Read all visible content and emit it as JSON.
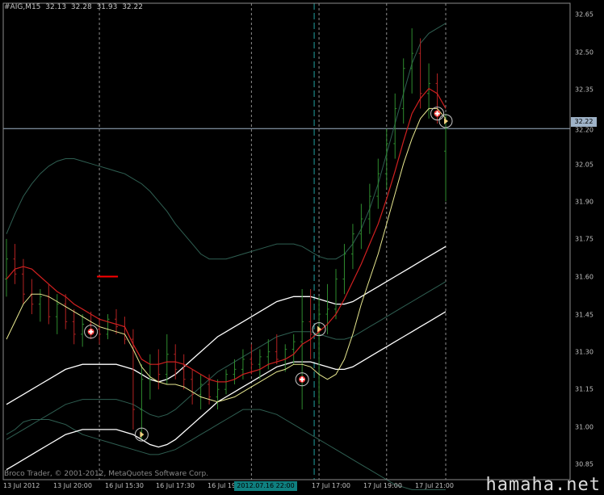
{
  "header": {
    "symbol": "#AIG,M15",
    "open": "32.13",
    "high": "32.28",
    "low": "31.93",
    "close": "32.22"
  },
  "copyright": "Broco Trader, © 2001-2012, MetaQuotes Software Corp.",
  "watermark": "hamaha.net",
  "price_axis": {
    "ticks": [
      "32.65",
      "32.50",
      "32.35",
      "32.20",
      "32.05",
      "31.90",
      "31.75",
      "31.60",
      "31.45",
      "31.30",
      "31.15",
      "31.00",
      "30.85"
    ],
    "current_price": "32.22"
  },
  "time_axis": {
    "ticks": [
      "13 Jul 2012",
      "13 Jul 20:00",
      "16 Jul 15:30",
      "16 Jul 17:30",
      "16 Jul 19:",
      "17 Jul 17:00",
      "17 Jul 19:00",
      "17 Jul 21:00"
    ],
    "crosshair_label": "2012.07.16 22:00"
  },
  "colors": {
    "background": "#000000",
    "bull": "#2e8b2e",
    "bear": "#b22222",
    "ma_fast": "#d02020",
    "ma_slow": "#e8e890",
    "envelope": "#ffffff",
    "band_outer": "#2f5f52",
    "crosshair": "#9fb3c8",
    "grid": "#8c8c8c"
  },
  "chart_data": {
    "type": "candlestick",
    "symbol": "#AIG",
    "timeframe": "M15",
    "ylim": [
      30.82,
      32.72
    ],
    "current_price": 32.22,
    "bars": [
      {
        "o": 31.62,
        "h": 31.78,
        "l": 31.55,
        "c": 31.7
      },
      {
        "o": 31.7,
        "h": 31.76,
        "l": 31.6,
        "c": 31.64
      },
      {
        "o": 31.64,
        "h": 31.7,
        "l": 31.52,
        "c": 31.56
      },
      {
        "o": 31.56,
        "h": 31.62,
        "l": 31.48,
        "c": 31.52
      },
      {
        "o": 31.52,
        "h": 31.58,
        "l": 31.45,
        "c": 31.55
      },
      {
        "o": 31.55,
        "h": 31.6,
        "l": 31.44,
        "c": 31.47
      },
      {
        "o": 31.47,
        "h": 31.56,
        "l": 31.4,
        "c": 31.52
      },
      {
        "o": 31.52,
        "h": 31.56,
        "l": 31.42,
        "c": 31.45
      },
      {
        "o": 31.45,
        "h": 31.5,
        "l": 31.36,
        "c": 31.4
      },
      {
        "o": 31.4,
        "h": 31.48,
        "l": 31.35,
        "c": 31.44
      },
      {
        "o": 31.44,
        "h": 31.49,
        "l": 31.38,
        "c": 31.42
      },
      {
        "o": 31.42,
        "h": 31.46,
        "l": 31.36,
        "c": 31.4
      },
      {
        "o": 31.4,
        "h": 31.48,
        "l": 31.38,
        "c": 31.46
      },
      {
        "o": 31.46,
        "h": 31.5,
        "l": 31.4,
        "c": 31.43
      },
      {
        "o": 31.43,
        "h": 31.47,
        "l": 31.36,
        "c": 31.38
      },
      {
        "o": 31.38,
        "h": 31.42,
        "l": 31.02,
        "c": 31.1
      },
      {
        "o": 31.1,
        "h": 31.28,
        "l": 30.98,
        "c": 31.22
      },
      {
        "o": 31.22,
        "h": 31.32,
        "l": 31.14,
        "c": 31.28
      },
      {
        "o": 31.28,
        "h": 31.34,
        "l": 31.18,
        "c": 31.24
      },
      {
        "o": 31.24,
        "h": 31.4,
        "l": 31.2,
        "c": 31.32
      },
      {
        "o": 31.32,
        "h": 31.36,
        "l": 31.22,
        "c": 31.26
      },
      {
        "o": 31.26,
        "h": 31.32,
        "l": 31.18,
        "c": 31.22
      },
      {
        "o": 31.22,
        "h": 31.26,
        "l": 31.12,
        "c": 31.16
      },
      {
        "o": 31.16,
        "h": 31.24,
        "l": 31.1,
        "c": 31.2
      },
      {
        "o": 31.2,
        "h": 31.24,
        "l": 31.12,
        "c": 31.15
      },
      {
        "o": 31.15,
        "h": 31.22,
        "l": 31.1,
        "c": 31.18
      },
      {
        "o": 31.18,
        "h": 31.26,
        "l": 31.16,
        "c": 31.24
      },
      {
        "o": 31.24,
        "h": 31.3,
        "l": 31.2,
        "c": 31.26
      },
      {
        "o": 31.26,
        "h": 31.34,
        "l": 31.22,
        "c": 31.3
      },
      {
        "o": 31.3,
        "h": 31.36,
        "l": 31.24,
        "c": 31.28
      },
      {
        "o": 31.28,
        "h": 31.34,
        "l": 31.22,
        "c": 31.31
      },
      {
        "o": 31.31,
        "h": 31.38,
        "l": 31.26,
        "c": 31.33
      },
      {
        "o": 31.33,
        "h": 31.4,
        "l": 31.28,
        "c": 31.3
      },
      {
        "o": 31.3,
        "h": 31.36,
        "l": 31.25,
        "c": 31.34
      },
      {
        "o": 31.34,
        "h": 31.4,
        "l": 31.28,
        "c": 31.37
      },
      {
        "o": 31.37,
        "h": 31.58,
        "l": 31.1,
        "c": 31.45
      },
      {
        "o": 31.45,
        "h": 31.58,
        "l": 31.3,
        "c": 31.4
      },
      {
        "o": 31.4,
        "h": 31.55,
        "l": 31.12,
        "c": 31.48
      },
      {
        "o": 31.48,
        "h": 31.6,
        "l": 31.4,
        "c": 31.5
      },
      {
        "o": 31.5,
        "h": 31.66,
        "l": 31.46,
        "c": 31.62
      },
      {
        "o": 31.62,
        "h": 31.76,
        "l": 31.56,
        "c": 31.72
      },
      {
        "o": 31.72,
        "h": 31.84,
        "l": 31.66,
        "c": 31.8
      },
      {
        "o": 31.8,
        "h": 31.92,
        "l": 31.74,
        "c": 31.86
      },
      {
        "o": 31.86,
        "h": 32.0,
        "l": 31.8,
        "c": 31.95
      },
      {
        "o": 31.95,
        "h": 32.1,
        "l": 31.9,
        "c": 32.04
      },
      {
        "o": 32.04,
        "h": 32.22,
        "l": 31.98,
        "c": 32.16
      },
      {
        "o": 32.16,
        "h": 32.36,
        "l": 32.1,
        "c": 32.3
      },
      {
        "o": 32.3,
        "h": 32.5,
        "l": 32.24,
        "c": 32.46
      },
      {
        "o": 32.46,
        "h": 32.62,
        "l": 32.36,
        "c": 32.52
      },
      {
        "o": 32.52,
        "h": 32.58,
        "l": 32.3,
        "c": 32.36
      },
      {
        "o": 32.36,
        "h": 32.48,
        "l": 32.26,
        "c": 32.4
      },
      {
        "o": 32.4,
        "h": 32.44,
        "l": 32.24,
        "c": 32.28
      },
      {
        "o": 32.13,
        "h": 32.28,
        "l": 31.93,
        "c": 32.22
      }
    ],
    "ma_fast": [
      31.62,
      31.66,
      31.67,
      31.66,
      31.63,
      31.6,
      31.57,
      31.55,
      31.52,
      31.5,
      31.48,
      31.46,
      31.45,
      31.44,
      31.43,
      31.36,
      31.3,
      31.28,
      31.28,
      31.29,
      31.29,
      31.28,
      31.26,
      31.24,
      31.22,
      31.21,
      31.21,
      31.22,
      31.24,
      31.25,
      31.26,
      31.28,
      31.29,
      31.3,
      31.32,
      31.36,
      31.38,
      31.41,
      31.44,
      31.48,
      31.54,
      31.61,
      31.68,
      31.76,
      31.84,
      31.94,
      32.05,
      32.17,
      32.28,
      32.34,
      32.38,
      32.36,
      32.3
    ],
    "ma_slow": [
      31.38,
      31.45,
      31.52,
      31.56,
      31.56,
      31.55,
      31.53,
      31.51,
      31.49,
      31.47,
      31.45,
      31.43,
      31.42,
      31.41,
      31.4,
      31.34,
      31.27,
      31.23,
      31.21,
      31.2,
      31.2,
      31.19,
      31.17,
      31.15,
      31.14,
      31.13,
      31.14,
      31.15,
      31.17,
      31.19,
      31.21,
      31.23,
      31.25,
      31.26,
      31.28,
      31.28,
      31.27,
      31.24,
      31.22,
      31.24,
      31.3,
      31.4,
      31.52,
      31.62,
      31.72,
      31.84,
      31.96,
      32.08,
      32.18,
      32.26,
      32.3,
      32.3,
      32.26
    ],
    "envelope_upper": [
      31.12,
      31.14,
      31.16,
      31.18,
      31.2,
      31.22,
      31.24,
      31.26,
      31.27,
      31.28,
      31.28,
      31.28,
      31.28,
      31.28,
      31.27,
      31.26,
      31.24,
      31.22,
      31.21,
      31.22,
      31.24,
      31.27,
      31.3,
      31.33,
      31.36,
      31.39,
      31.41,
      31.43,
      31.45,
      31.47,
      31.49,
      31.51,
      31.53,
      31.54,
      31.55,
      31.55,
      31.55,
      31.54,
      31.53,
      31.52,
      31.52,
      31.53,
      31.55,
      31.57,
      31.59,
      31.61,
      31.63,
      31.65,
      31.67,
      31.69,
      31.71,
      31.73,
      31.75
    ],
    "envelope_mid": [
      30.98,
      31.0,
      31.02,
      31.04,
      31.06,
      31.08,
      31.1,
      31.12,
      31.13,
      31.14,
      31.14,
      31.14,
      31.14,
      31.14,
      31.13,
      31.12,
      31.1,
      31.08,
      31.07,
      31.08,
      31.1,
      31.13,
      31.16,
      31.19,
      31.22,
      31.25,
      31.27,
      31.29,
      31.31,
      31.33,
      31.35,
      31.37,
      31.39,
      31.4,
      31.41,
      31.41,
      31.41,
      31.4,
      31.39,
      31.38,
      31.38,
      31.39,
      31.41,
      31.43,
      31.45,
      31.47,
      31.49,
      31.51,
      31.53,
      31.55,
      31.57,
      31.59,
      31.61
    ],
    "envelope_lower": [
      30.86,
      30.88,
      30.9,
      30.92,
      30.94,
      30.96,
      30.98,
      31.0,
      31.01,
      31.02,
      31.02,
      31.02,
      31.02,
      31.02,
      31.01,
      31.0,
      30.98,
      30.96,
      30.95,
      30.96,
      30.98,
      31.01,
      31.04,
      31.07,
      31.1,
      31.13,
      31.15,
      31.17,
      31.19,
      31.21,
      31.23,
      31.25,
      31.27,
      31.28,
      31.29,
      31.29,
      31.29,
      31.28,
      31.27,
      31.26,
      31.26,
      31.27,
      31.29,
      31.31,
      31.33,
      31.35,
      31.37,
      31.39,
      31.41,
      31.43,
      31.45,
      31.47,
      31.49
    ],
    "band_upper": [
      31.8,
      31.88,
      31.95,
      32.0,
      32.04,
      32.07,
      32.09,
      32.1,
      32.1,
      32.09,
      32.08,
      32.07,
      32.06,
      32.05,
      32.04,
      32.02,
      32.0,
      31.97,
      31.93,
      31.89,
      31.84,
      31.8,
      31.76,
      31.72,
      31.7,
      31.7,
      31.7,
      31.71,
      31.72,
      31.73,
      31.74,
      31.75,
      31.76,
      31.76,
      31.76,
      31.75,
      31.73,
      31.71,
      31.7,
      31.7,
      31.72,
      31.76,
      31.82,
      31.9,
      32.0,
      32.12,
      32.24,
      32.36,
      32.48,
      32.56,
      32.6,
      32.62,
      32.64
    ],
    "band_lower": [
      31.0,
      31.02,
      31.05,
      31.06,
      31.06,
      31.06,
      31.05,
      31.04,
      31.02,
      31.0,
      30.99,
      30.98,
      30.97,
      30.96,
      30.95,
      30.94,
      30.93,
      30.92,
      30.92,
      30.93,
      30.94,
      30.96,
      30.98,
      31.0,
      31.02,
      31.04,
      31.06,
      31.08,
      31.1,
      31.1,
      31.1,
      31.09,
      31.08,
      31.06,
      31.04,
      31.02,
      31.0,
      30.98,
      30.96,
      30.94,
      30.92,
      30.9,
      30.88,
      30.86,
      30.84,
      30.82,
      30.8,
      30.79,
      30.78,
      30.78,
      30.78,
      30.78,
      30.78
    ],
    "signals": [
      {
        "bar": 10,
        "price": 31.41,
        "type": "buy"
      },
      {
        "bar": 16,
        "price": 31.0,
        "type": "sell"
      },
      {
        "bar": 35,
        "price": 31.22,
        "type": "buy"
      },
      {
        "bar": 37,
        "price": 31.42,
        "type": "sell"
      },
      {
        "bar": 51,
        "price": 32.28,
        "type": "buy"
      },
      {
        "bar": 52,
        "price": 32.25,
        "type": "sell"
      }
    ],
    "level_marker": {
      "bar": 11,
      "price": 31.63
    },
    "period_separators": [
      11,
      29,
      37,
      45,
      52
    ]
  }
}
